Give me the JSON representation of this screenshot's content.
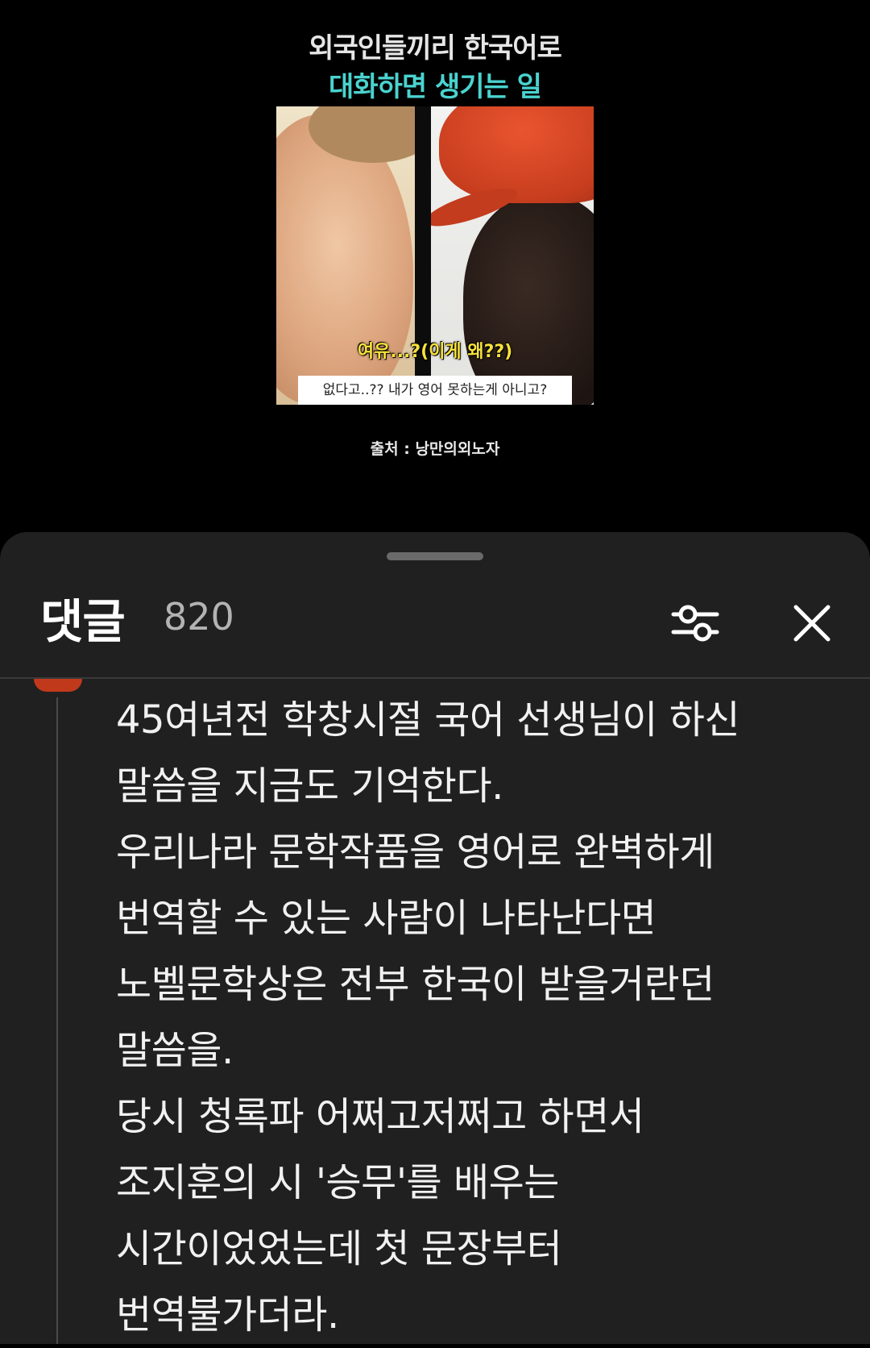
{
  "video": {
    "title_line1": "외국인들끼리 한국어로",
    "title_line2": "대화하면 생기는 일",
    "subtitle_yellow": "여유...?(이게 왜??)",
    "subtitle_white": "없다고..?? 내가 영어 못하는게 아니고?",
    "source": "출처 : 낭만의외노자"
  },
  "comments": {
    "title": "댓글",
    "count": "820",
    "filter_icon": "sliders-icon",
    "close_icon": "close-icon"
  },
  "comment": {
    "lines": [
      "45여년전 학창시절 국어 선생님이 하신",
      "말씀을 지금도 기억한다.",
      "우리나라 문학작품을 영어로 완벽하게",
      "번역할 수 있는 사람이 나타난다면",
      "노벨문학상은 전부 한국이 받을거란던",
      "말씀을.",
      "당시 청록파 어쩌고저쩌고 하면서",
      "조지훈의 시 '승무'를 배우는",
      "시간이었었는데 첫 문장부터",
      "번역불가더라."
    ]
  },
  "colors": {
    "sheet_bg": "#202020",
    "title_accent": "#4ad3cf",
    "subtitle_yellow": "#f7e23b",
    "avatar": "#c0391b"
  }
}
